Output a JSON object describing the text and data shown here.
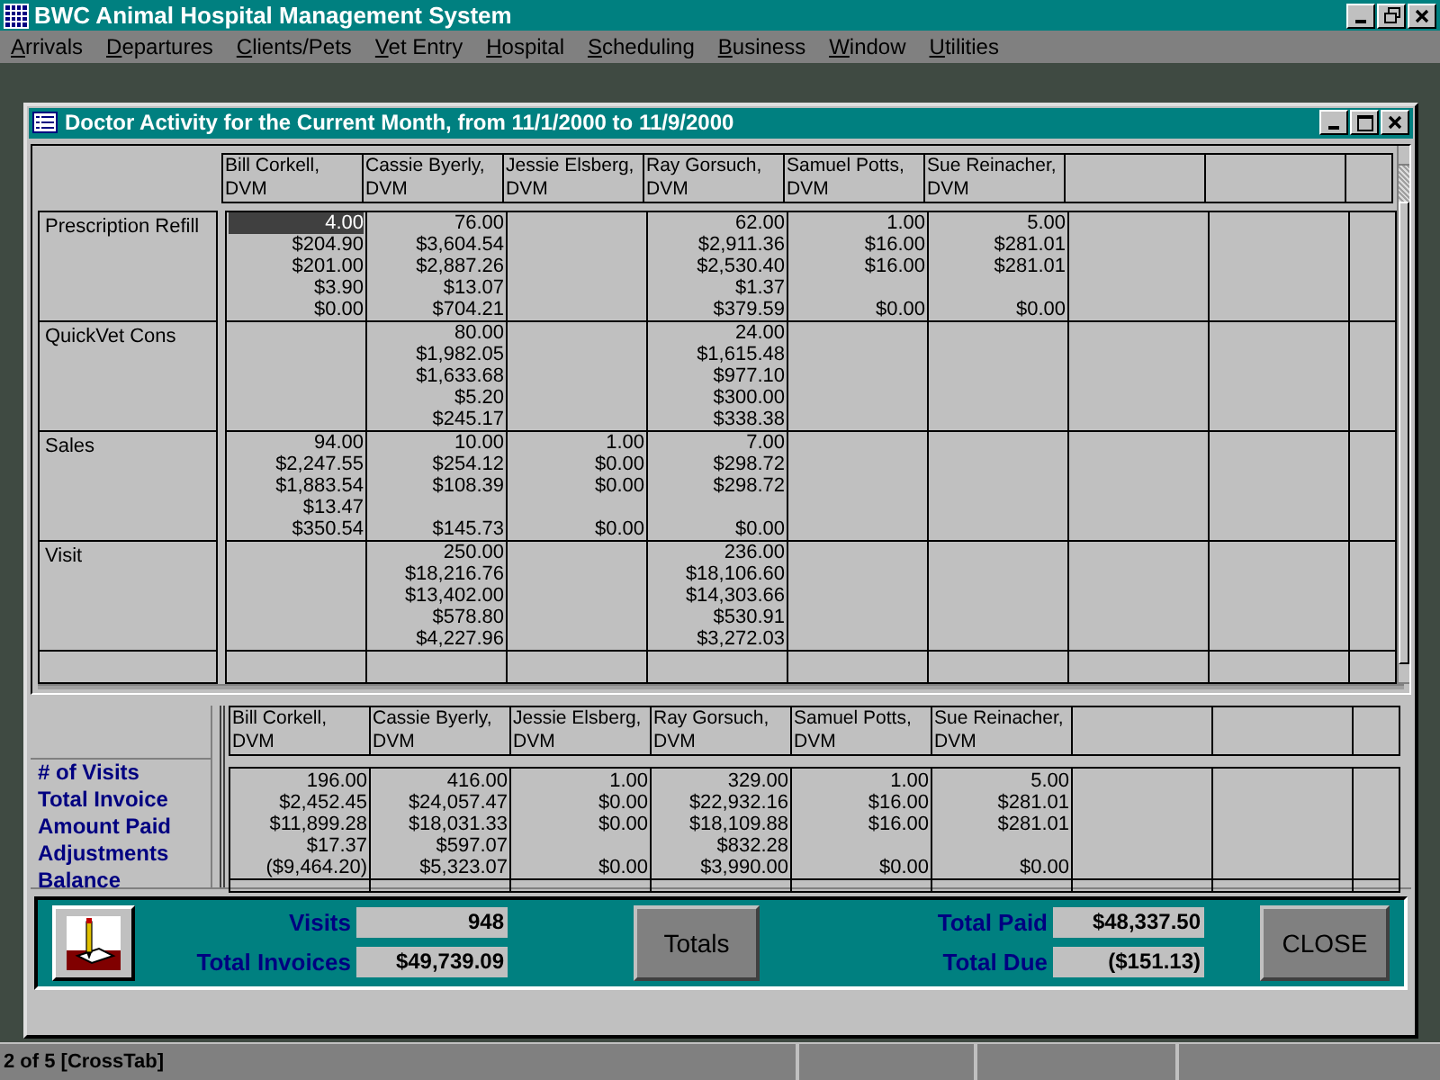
{
  "app": {
    "title": "BWC Animal Hospital Management System"
  },
  "menu": [
    "Arrivals",
    "Departures",
    "Clients/Pets",
    "Vet Entry",
    "Hospital",
    "Scheduling",
    "Business",
    "Window",
    "Utilities"
  ],
  "window": {
    "title": "Doctor Activity for the Current Month, from 11/1/2000 to 11/9/2000"
  },
  "crosstab": {
    "columns": [
      "Bill Corkell, DVM",
      "Cassie Byerly, DVM",
      "Jessie Elsberg, DVM",
      "Ray Gorsuch, DVM",
      "Samuel Potts, DVM",
      "Sue Reinacher, DVM"
    ],
    "rows": [
      {
        "label": "Prescription Refill",
        "cells": [
          {
            "selected": true,
            "values": {
              "visits": "4.00",
              "invoice": "$204.90",
              "paid": "$201.00",
              "adjustments": "$3.90",
              "balance": "$0.00"
            }
          },
          {
            "selected": false,
            "values": {
              "visits": "76.00",
              "invoice": "$3,604.54",
              "paid": "$2,887.26",
              "adjustments": "$13.07",
              "balance": "$704.21"
            }
          },
          {
            "selected": false
          },
          {
            "selected": false,
            "values": {
              "visits": "62.00",
              "invoice": "$2,911.36",
              "paid": "$2,530.40",
              "adjustments": "$1.37",
              "balance": "$379.59"
            }
          },
          {
            "selected": false,
            "values": {
              "visits": "1.00",
              "invoice": "$16.00",
              "paid": "$16.00",
              "balance": "$0.00"
            }
          },
          {
            "selected": false,
            "values": {
              "visits": "5.00",
              "invoice": "$281.01",
              "paid": "$281.01",
              "balance": "$0.00"
            }
          }
        ]
      },
      {
        "label": "QuickVet Cons",
        "cells": [
          {
            "selected": false
          },
          {
            "selected": false,
            "values": {
              "visits": "80.00",
              "invoice": "$1,982.05",
              "paid": "$1,633.68",
              "adjustments": "$5.20",
              "balance": "$245.17"
            }
          },
          {
            "selected": false
          },
          {
            "selected": false,
            "values": {
              "visits": "24.00",
              "invoice": "$1,615.48",
              "paid": "$977.10",
              "adjustments": "$300.00",
              "balance": "$338.38"
            }
          },
          {
            "selected": false
          },
          {
            "selected": false
          }
        ]
      },
      {
        "label": "Sales",
        "cells": [
          {
            "selected": false,
            "values": {
              "visits": "94.00",
              "invoice": "$2,247.55",
              "paid": "$1,883.54",
              "adjustments": "$13.47",
              "balance": "$350.54"
            }
          },
          {
            "selected": false,
            "values": {
              "visits": "10.00",
              "invoice": "$254.12",
              "paid": "$108.39",
              "balance": "$145.73"
            }
          },
          {
            "selected": false,
            "values": {
              "visits": "1.00",
              "invoice": "$0.00",
              "paid": "$0.00",
              "balance": "$0.00"
            }
          },
          {
            "selected": false,
            "values": {
              "visits": "7.00",
              "invoice": "$298.72",
              "paid": "$298.72",
              "balance": "$0.00"
            }
          },
          {
            "selected": false
          },
          {
            "selected": false
          }
        ]
      },
      {
        "label": "Visit",
        "cells": [
          {
            "selected": false
          },
          {
            "selected": false,
            "values": {
              "visits": "250.00",
              "invoice": "$18,216.76",
              "paid": "$13,402.00",
              "adjustments": "$578.80",
              "balance": "$4,227.96"
            }
          },
          {
            "selected": false
          },
          {
            "selected": false,
            "values": {
              "visits": "236.00",
              "invoice": "$18,106.60",
              "paid": "$14,303.66",
              "adjustments": "$530.91",
              "balance": "$3,272.03"
            }
          },
          {
            "selected": false
          },
          {
            "selected": false
          }
        ]
      }
    ]
  },
  "summary": {
    "labels": [
      "# of Visits",
      "Total Invoice",
      "Amount Paid",
      "Adjustments",
      "Balance"
    ],
    "columns": [
      "Bill Corkell, DVM",
      "Cassie Byerly, DVM",
      "Jessie Elsberg, DVM",
      "Ray Gorsuch, DVM",
      "Samuel Potts, DVM",
      "Sue Reinacher, DVM"
    ],
    "cells": [
      {
        "visits": "196.00",
        "invoice": "$2,452.45",
        "paid": "$11,899.28",
        "adjustments": "$17.37",
        "balance": "($9,464.20)"
      },
      {
        "visits": "416.00",
        "invoice": "$24,057.47",
        "paid": "$18,031.33",
        "adjustments": "$597.07",
        "balance": "$5,323.07"
      },
      {
        "visits": "1.00",
        "invoice": "$0.00",
        "paid": "$0.00",
        "balance": "$0.00"
      },
      {
        "visits": "329.00",
        "invoice": "$22,932.16",
        "paid": "$18,109.88",
        "adjustments": "$832.28",
        "balance": "$3,990.00"
      },
      {
        "visits": "1.00",
        "invoice": "$16.00",
        "paid": "$16.00",
        "balance": "$0.00"
      },
      {
        "visits": "5.00",
        "invoice": "$281.01",
        "paid": "$281.01",
        "balance": "$0.00"
      }
    ]
  },
  "totals": {
    "left": [
      {
        "label": "Visits",
        "value": "948"
      },
      {
        "label": "Total Invoices",
        "value": "$49,739.09"
      }
    ],
    "totals_button": "Totals",
    "right": [
      {
        "label": "Total Paid",
        "value": "$48,337.50"
      },
      {
        "label": "Total Due",
        "value": "($151.13)"
      }
    ],
    "close_button": "CLOSE"
  },
  "status_bar": {
    "text": "2 of 5 [CrossTab]"
  }
}
